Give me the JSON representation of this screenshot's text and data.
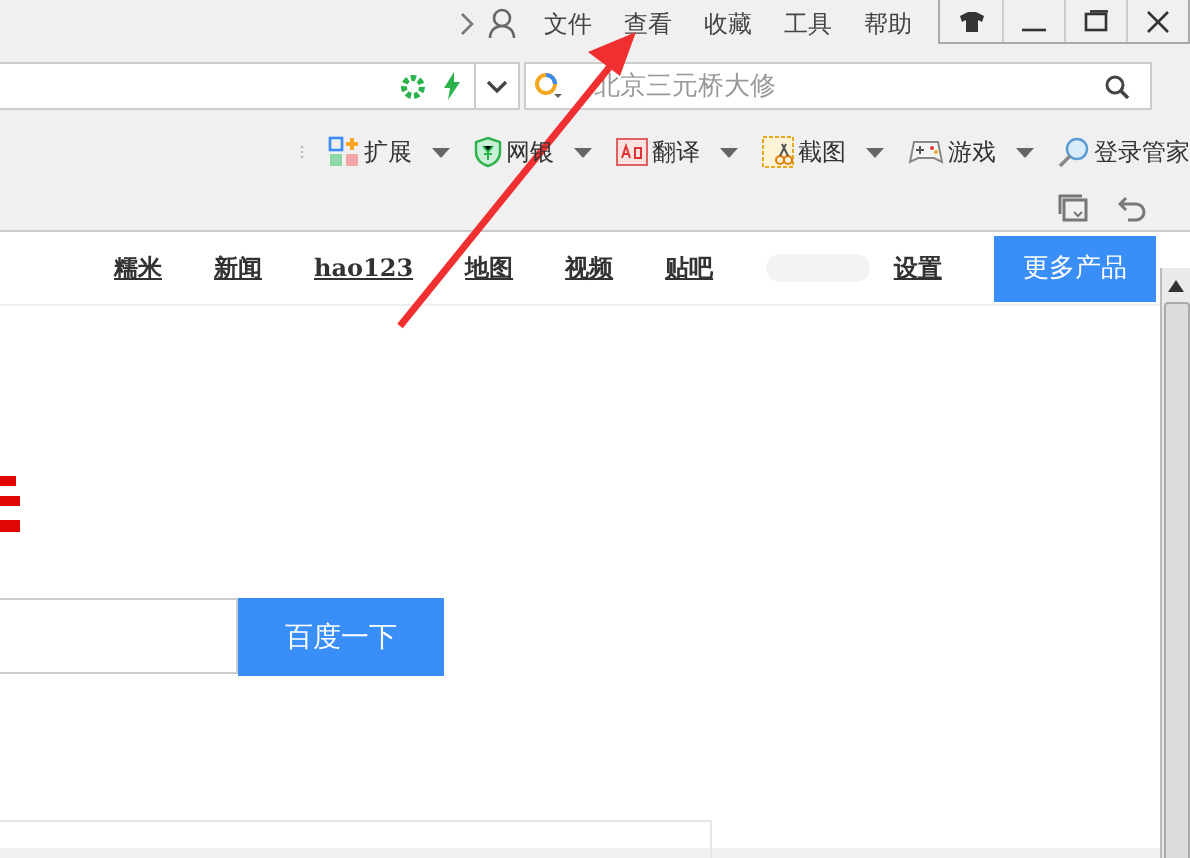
{
  "menu": [
    "文件",
    "查看",
    "收藏",
    "工具",
    "帮助"
  ],
  "search": {
    "placeholder": "北京三元桥大修"
  },
  "toolbar": [
    {
      "label": "扩展",
      "kind": "grid",
      "dropdown": true
    },
    {
      "label": "网银",
      "kind": "shield",
      "dropdown": true
    },
    {
      "label": "翻译",
      "kind": "translate",
      "dropdown": true
    },
    {
      "label": "截图",
      "kind": "scissors",
      "dropdown": true
    },
    {
      "label": "游戏",
      "kind": "gamepad",
      "dropdown": true
    },
    {
      "label": "登录管家",
      "kind": "key",
      "dropdown": false
    }
  ],
  "nav_links": [
    "糯米",
    "新闻",
    "hao123",
    "地图",
    "视频",
    "贴吧",
    "设置"
  ],
  "more_button": "更多产品",
  "search_button": "百度一下"
}
